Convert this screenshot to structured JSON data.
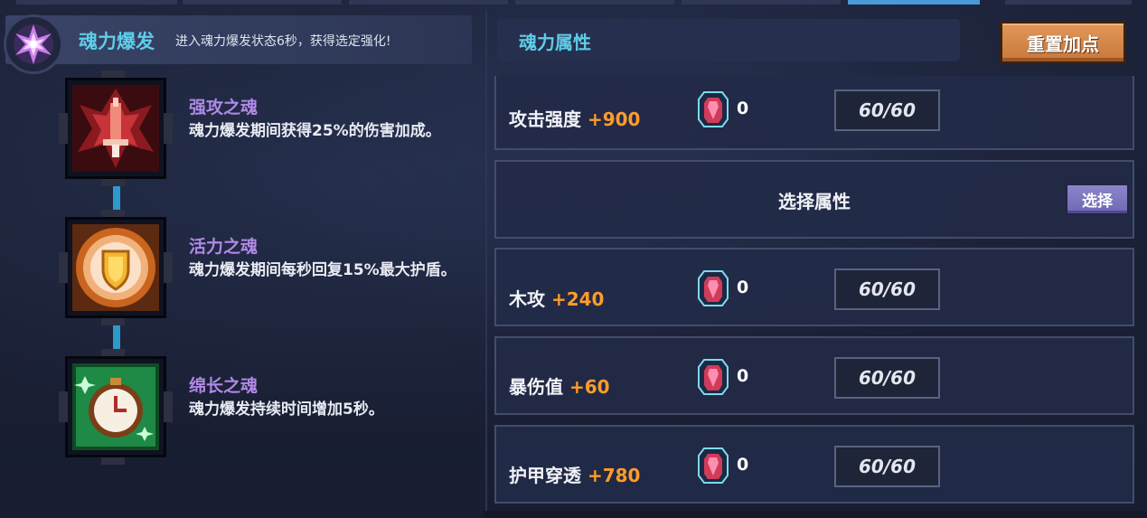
{
  "burst": {
    "title": "魂力爆发",
    "description": "进入魂力爆发状态6秒，获得选定强化!",
    "icon": "purple-star-burst-icon"
  },
  "souls": [
    {
      "name": "强攻之魂",
      "description": "魂力爆发期间获得25%的伤害加成。",
      "icon": "red-sword-soul-icon"
    },
    {
      "name": "活力之魂",
      "description": "魂力爆发期间每秒回复15%最大护盾。",
      "icon": "orange-shield-soul-icon"
    },
    {
      "name": "绵长之魂",
      "description": "魂力爆发持续时间增加5秒。",
      "icon": "green-clock-soul-icon"
    }
  ],
  "attributes": {
    "title": "魂力属性",
    "reset_label": "重置加点",
    "rows": [
      {
        "name": "攻击强度",
        "bonus": "+900",
        "gem_count": "0",
        "level": "60/60"
      },
      {
        "name": "木攻",
        "bonus": "+240",
        "gem_count": "0",
        "level": "60/60"
      },
      {
        "name": "暴伤值",
        "bonus": "+60",
        "gem_count": "0",
        "level": "60/60"
      },
      {
        "name": "护甲穿透",
        "bonus": "+780",
        "gem_count": "0",
        "level": "60/60"
      }
    ],
    "select_slot": {
      "title": "选择属性",
      "button_label": "选择"
    }
  },
  "colors": {
    "accent_cyan": "#5ecde8",
    "soul_name": "#b089e6",
    "bonus_orange": "#ff9c2a",
    "reset_button": "#d98a4a",
    "select_button": "#7c77bf"
  }
}
